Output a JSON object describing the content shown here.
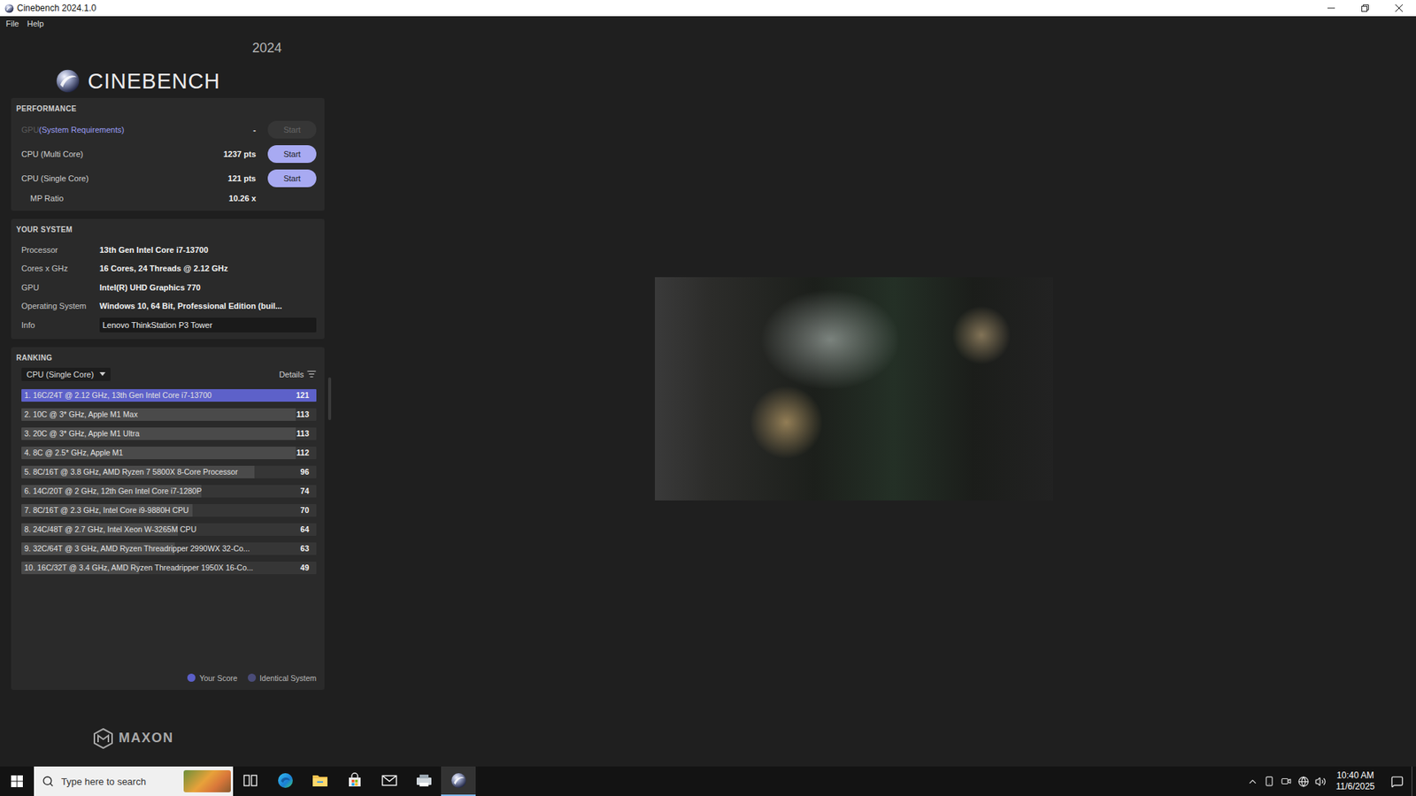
{
  "window": {
    "title": "Cinebench 2024.1.0"
  },
  "menu": [
    "File",
    "Help"
  ],
  "logo": {
    "name": "CINEBENCH",
    "year": "2024"
  },
  "performance": {
    "title": "PERFORMANCE",
    "tests": [
      {
        "name": "GPU",
        "note": "(System Requirements)",
        "score": "-",
        "button": "Start",
        "disabled": true
      },
      {
        "name": "CPU (Multi Core)",
        "note": "",
        "score": "1237 pts",
        "button": "Start",
        "disabled": false
      },
      {
        "name": "CPU (Single Core)",
        "note": "",
        "score": "121 pts",
        "button": "Start",
        "disabled": false
      }
    ],
    "ratio": {
      "label": "MP Ratio",
      "value": "10.26 x"
    }
  },
  "system": {
    "title": "YOUR SYSTEM",
    "rows": [
      {
        "label": "Processor",
        "value": "13th Gen Intel Core i7-13700",
        "kind": "text"
      },
      {
        "label": "Cores x GHz",
        "value": "16 Cores, 24 Threads @ 2.12 GHz",
        "kind": "text"
      },
      {
        "label": "GPU",
        "value": "Intel(R) UHD Graphics 770",
        "kind": "text"
      },
      {
        "label": "Operating System",
        "value": "Windows 10, 64 Bit, Professional Edition (buil...",
        "kind": "text"
      },
      {
        "label": "Info",
        "value": "Lenovo ThinkStation P3 Tower",
        "kind": "input"
      }
    ]
  },
  "ranking": {
    "title": "RANKING",
    "filter": "CPU (Single Core)",
    "details": "Details",
    "rows": [
      {
        "label": "1. 16C/24T @ 2.12 GHz, 13th Gen Intel Core i7-13700",
        "score": "121",
        "level": 1.0,
        "yours": true
      },
      {
        "label": "2. 10C @ 3* GHz, Apple M1 Max",
        "score": "113",
        "level": 0.93,
        "yours": false
      },
      {
        "label": "3. 20C @ 3* GHz, Apple M1 Ultra",
        "score": "113",
        "level": 0.93,
        "yours": false
      },
      {
        "label": "4. 8C @ 2.5* GHz, Apple M1",
        "score": "112",
        "level": 0.93,
        "yours": false
      },
      {
        "label": "5. 8C/16T @ 3.8 GHz, AMD Ryzen 7 5800X 8-Core Processor",
        "score": "96",
        "level": 0.79,
        "yours": false
      },
      {
        "label": "6. 14C/20T @ 2 GHz, 12th Gen Intel Core i7-1280P",
        "score": "74",
        "level": 0.61,
        "yours": false
      },
      {
        "label": "7. 8C/16T @ 2.3 GHz, Intel Core i9-9880H CPU",
        "score": "70",
        "level": 0.58,
        "yours": false
      },
      {
        "label": "8. 24C/48T @ 2.7 GHz, Intel Xeon W-3265M CPU",
        "score": "64",
        "level": 0.53,
        "yours": false
      },
      {
        "label": "9. 32C/64T @ 3 GHz, AMD Ryzen Threadripper 2990WX 32-Co...",
        "score": "63",
        "level": 0.52,
        "yours": false
      },
      {
        "label": "10. 16C/32T @ 3.4 GHz, AMD Ryzen Threadripper 1950X 16-Co...",
        "score": "49",
        "level": 0.4,
        "yours": false
      }
    ],
    "legend": [
      {
        "label": "Your Score",
        "color": "#5b5fc8"
      },
      {
        "label": "Identical System",
        "color": "#4a4c78"
      }
    ]
  },
  "brand": {
    "name": "MAXON"
  },
  "taskbar": {
    "search_placeholder": "Type here to search",
    "apps": [
      {
        "kind": "task-view",
        "selected": false
      },
      {
        "kind": "edge",
        "selected": false
      },
      {
        "kind": "explorer",
        "selected": false
      },
      {
        "kind": "store",
        "selected": false
      },
      {
        "kind": "mail",
        "selected": false
      },
      {
        "kind": "device",
        "selected": false
      },
      {
        "kind": "cinebench",
        "selected": true
      }
    ],
    "tray": [
      {
        "kind": "overflow"
      },
      {
        "kind": "phone"
      },
      {
        "kind": "meet"
      },
      {
        "kind": "network"
      },
      {
        "kind": "volume"
      }
    ],
    "clock": {
      "time": "10:40 AM",
      "date": "11/6/2025"
    }
  }
}
